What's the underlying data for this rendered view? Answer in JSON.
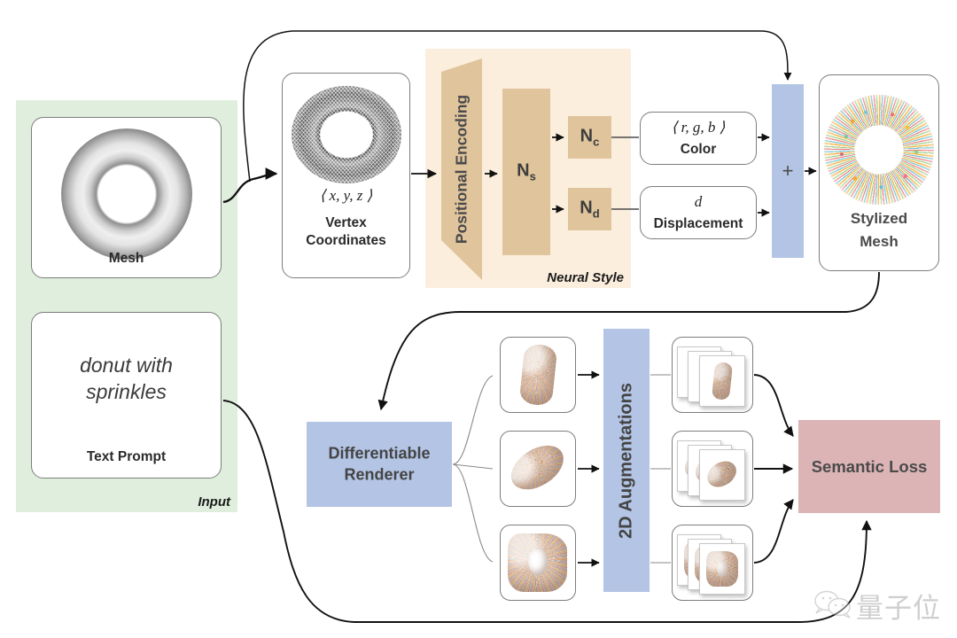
{
  "figure": {
    "title": "Text2Mesh style pipeline diagram",
    "groups": {
      "input_caption": "Input",
      "neural_style_caption": "Neural Style"
    },
    "colors": {
      "input_panel": "#dfeedd",
      "neural_panel": "#fbeedd",
      "neural_block": "#dfc49c",
      "blue_block": "#b3c4e4",
      "loss_block": "#dcb4b6",
      "card_border": "#7d7d7d",
      "text": "#3d3d3d"
    }
  },
  "input": {
    "mesh_card": {
      "label": "Mesh",
      "icon": "grey-torus-mesh"
    },
    "prompt_card": {
      "prompt": "donut with sprinkles",
      "label": "Text Prompt"
    }
  },
  "vertex": {
    "math": "⟨ x, y, z ⟩",
    "label": "Vertex\nCoordinates",
    "label_line1": "Vertex",
    "label_line2": "Coordinates",
    "icon": "wireframe-torus"
  },
  "neural_style": {
    "positional_encoding": "Positional Encoding",
    "ns": "N",
    "ns_sub": "s",
    "nc": "N",
    "nc_sub": "c",
    "nd": "N",
    "nd_sub": "d"
  },
  "outputs": {
    "color": {
      "math": "⟨ r, g, b ⟩",
      "label": "Color"
    },
    "displacement": {
      "math": "d",
      "label": "Displacement"
    }
  },
  "combine": {
    "operator": "+"
  },
  "stylized": {
    "label_line1": "Stylized",
    "label_line2": "Mesh",
    "icon": "sprinkled-torus"
  },
  "renderer": {
    "label_line1": "Differentiable",
    "label_line2": "Renderer"
  },
  "augmentations": {
    "label": "2D Augmentations"
  },
  "loss": {
    "label": "Semantic  Loss"
  },
  "views": [
    {
      "name": "view-1",
      "icon": "donut-render-tall"
    },
    {
      "name": "view-2",
      "icon": "donut-render-diagonal"
    },
    {
      "name": "view-3",
      "icon": "donut-render-ring"
    }
  ],
  "augmented_stacks": [
    {
      "name": "aug-stack-1",
      "sheets": 3,
      "icon": "donut-render-tall"
    },
    {
      "name": "aug-stack-2",
      "sheets": 3,
      "icon": "donut-render-diagonal"
    },
    {
      "name": "aug-stack-3",
      "sheets": 3,
      "icon": "donut-render-ring"
    }
  ],
  "watermark": {
    "text": "量子位",
    "icon": "wechat-logo"
  }
}
